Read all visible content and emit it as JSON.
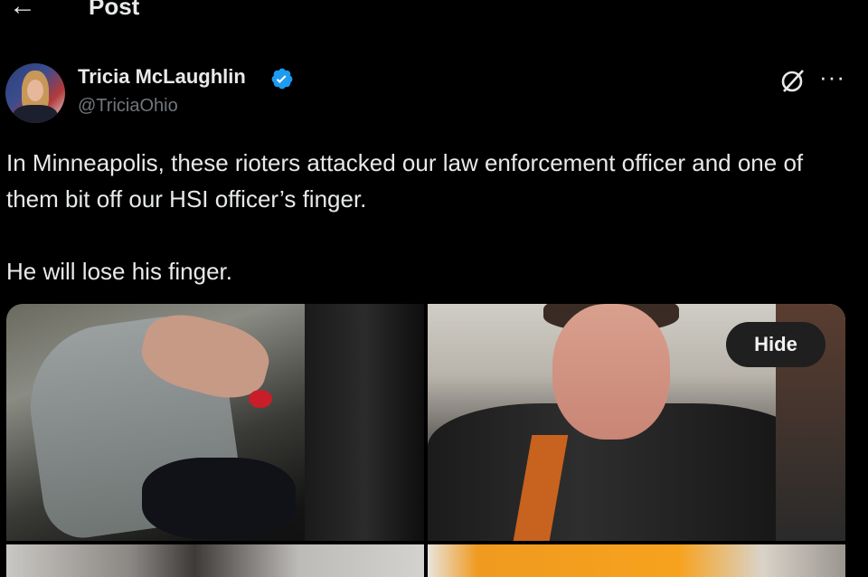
{
  "header": {
    "title": "Post",
    "back_icon": "arrow-left-icon"
  },
  "author": {
    "name": "Tricia McLaughlin",
    "handle": "@TriciaOhio",
    "verified": true,
    "verified_color": "#1d9bf0"
  },
  "actions": {
    "grok_icon": "grok-icon",
    "more_label": "···"
  },
  "tweet": {
    "paragraphs": [
      "In Minneapolis, these rioters attacked our law enforcement officer and one of them bit off our HSI officer’s finger.",
      "He will lose his finger."
    ]
  },
  "media": {
    "hide_label": "Hide",
    "tile_count": 4
  }
}
